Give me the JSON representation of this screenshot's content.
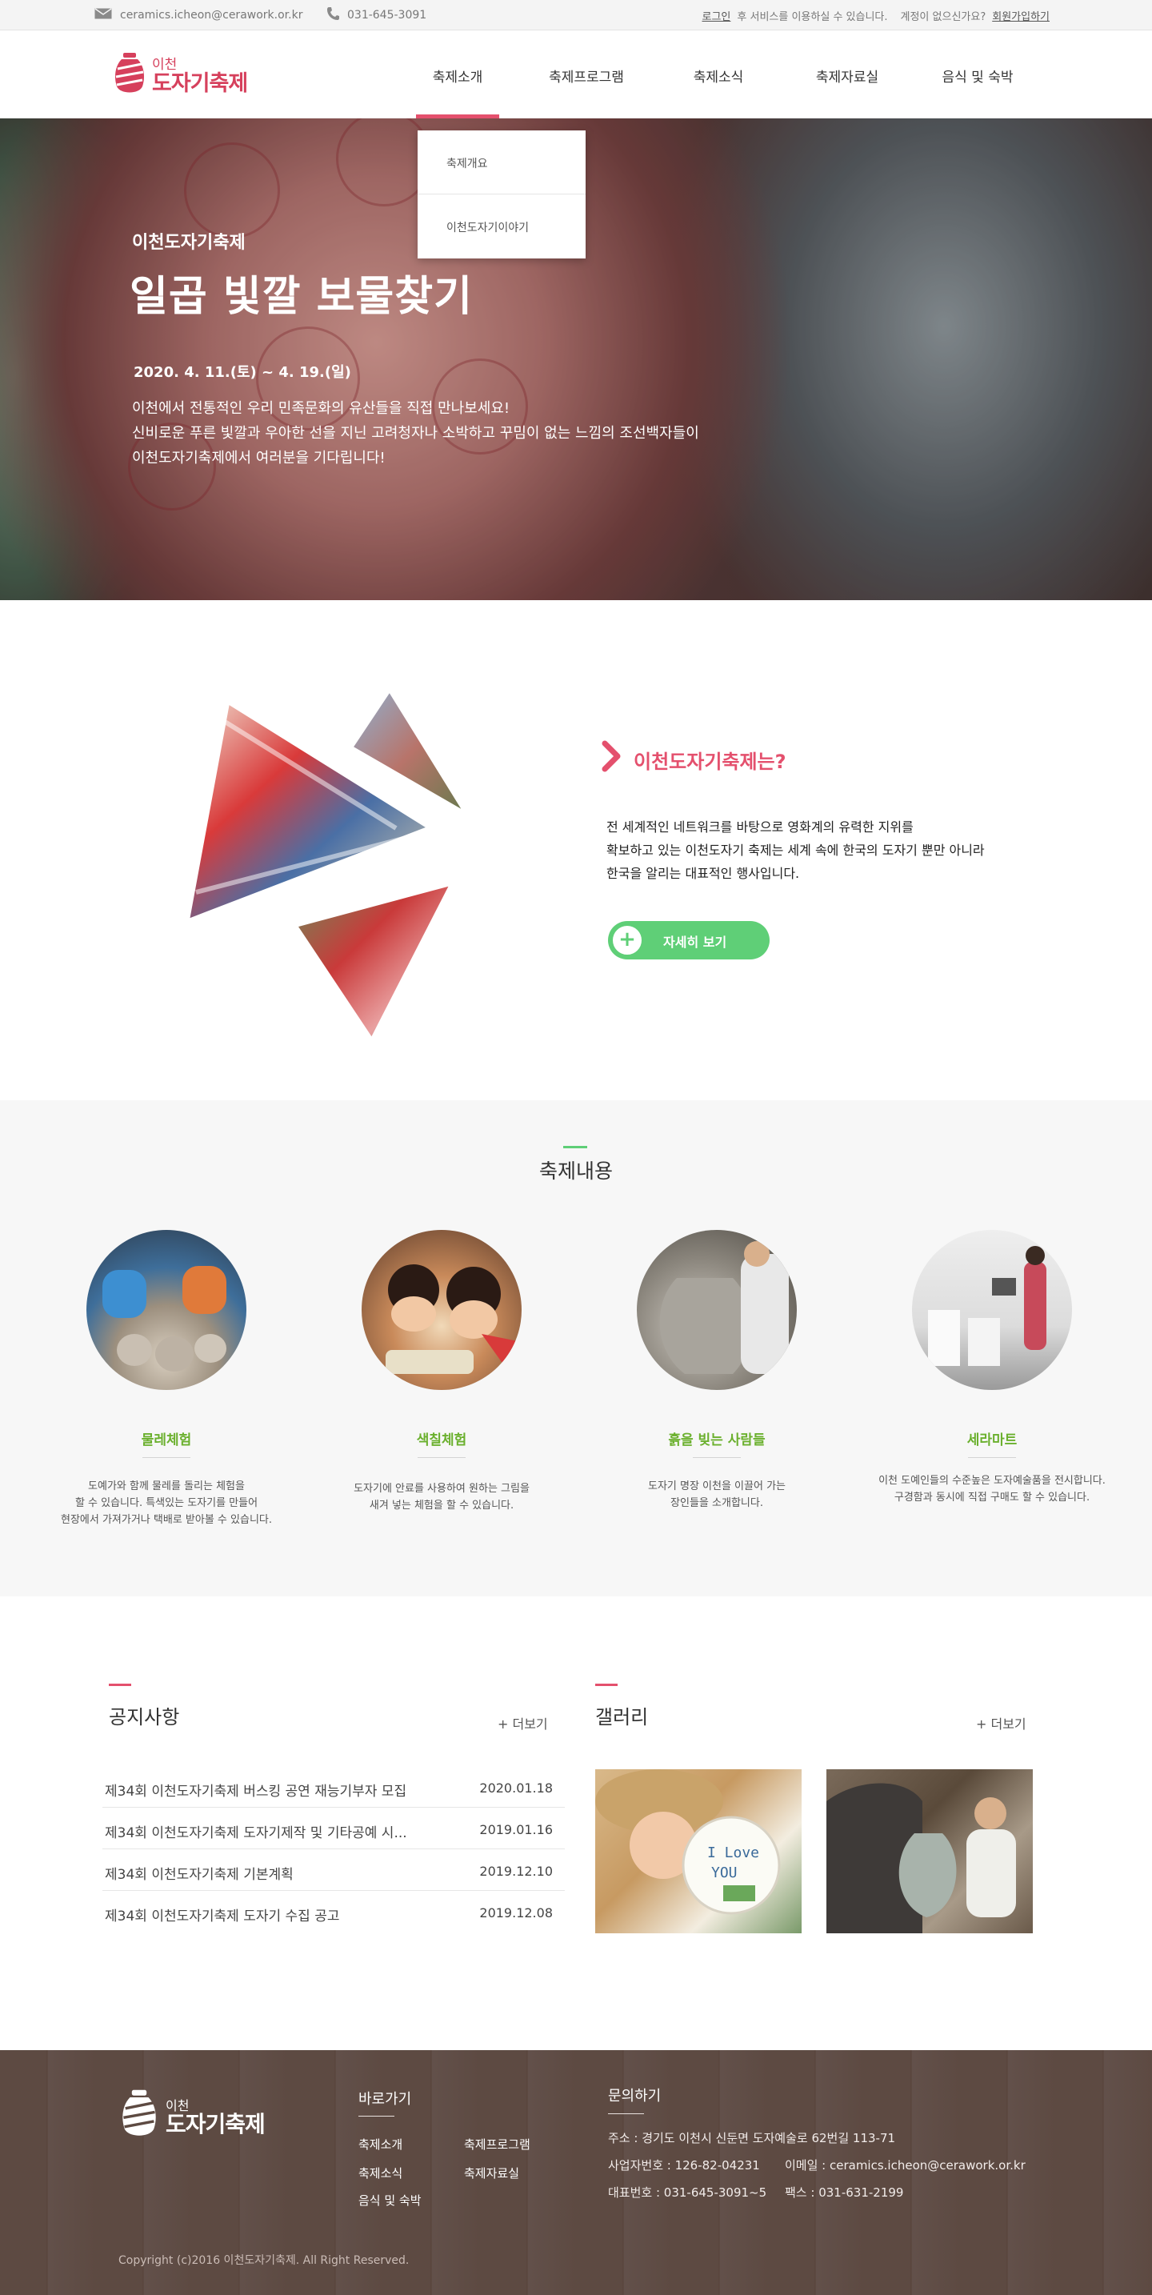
{
  "topbar": {
    "email": "ceramics.icheon@cerawork.or.kr",
    "phone": "031-645-3091",
    "login_link": "로그인",
    "login_suffix": "후 서비스를 이용하실 수 있습니다.",
    "no_account": "계정이 없으신가요?",
    "signup_link": "회원가입하기"
  },
  "logo": {
    "small": "이천",
    "big": "도자기축제"
  },
  "nav": [
    "축제소개",
    "축제프로그램",
    "축제소식",
    "축제자료실",
    "음식 및 숙박"
  ],
  "dropdown": [
    "축제개요",
    "이천도자기이야기"
  ],
  "hero": {
    "subtitle": "이천도자기축제",
    "title": "일곱 빛깔 보물찾기",
    "date": "2020. 4. 11.(토) ~ 4. 19.(일)",
    "desc": [
      "이천에서 전통적인 우리 민족문화의 유산들을 직접 만나보세요!",
      "신비로운 푸른 빛깔과 우아한 선을 지닌 고려청자나 소박하고 꾸밈이 없는 느낌의 조선백자들이",
      "이천도자기축제에서 여러분을 기다립니다!"
    ]
  },
  "about": {
    "heading": "이천도자기축제는?",
    "text": [
      "전 세계적인 네트워크를 바탕으로 영화계의 유력한 지위를",
      "확보하고 있는 이천도자기 축제는 세계 속에 한국의 도자기 뿐만 아니라",
      "한국을 알리는 대표적인 행사입니다."
    ],
    "button": "자세히 보기"
  },
  "contents": {
    "heading": "축제내용",
    "items": [
      {
        "title": "물레체험",
        "desc": [
          "도예가와 함께 물레를 돌리는 체험을",
          "할 수 있습니다. 특색있는 도자기를 만들어",
          "현장에서 가져가거나 택배로 받아볼 수 있습니다."
        ]
      },
      {
        "title": "색칠체험",
        "desc": [
          "도자기에 안료를 사용하여 원하는 그림을",
          "새겨 넣는 체험을 할 수 있습니다."
        ]
      },
      {
        "title": "흙을 빚는 사람들",
        "desc": [
          "도자기 명장 이천을 이끌어 가는",
          "장인들을 소개합니다."
        ]
      },
      {
        "title": "세라마트",
        "desc": [
          "이천 도예인들의 수준높은 도자예술품을 전시합니다.",
          "구경함과 동시에 직접 구매도 할 수 있습니다."
        ]
      }
    ]
  },
  "notice": {
    "title": "공지사항",
    "more": "+ 더보기",
    "rows": [
      {
        "title": "제34회 이천도자기축제 버스킹 공연 재능기부자 모집",
        "date": "2020.01.18"
      },
      {
        "title": "제34회 이천도자기축제 도자기제작 및 기타공예 시...",
        "date": "2019.01.16"
      },
      {
        "title": "제34회 이천도자기축제 기본계획",
        "date": "2019.12.10"
      },
      {
        "title": "제34회 이천도자기축제 도자기 수집 공고",
        "date": "2019.12.08"
      }
    ]
  },
  "gallery": {
    "title": "갤러리",
    "more": "+ 더보기"
  },
  "footer": {
    "logo_small": "이천",
    "logo_big": "도자기축제",
    "quick_title": "바로가기",
    "quick_links": [
      "축제소개",
      "축제프로그램",
      "축제소식",
      "축제자료실",
      "음식 및 숙박"
    ],
    "contact_title": "문의하기",
    "address": "주소 : 경기도 이천시 신둔면 도자예술로 62번길 113-71",
    "biz": "사업자번호 : 126-82-04231",
    "email": "이메일 : ceramics.icheon@cerawork.or.kr",
    "tel": "대표번호 : 031-645-3091~5",
    "fax": "팩스 : 031-631-2199",
    "copyright": "Copyright (c)2016 이천도자기축제. All Right Reserved."
  }
}
